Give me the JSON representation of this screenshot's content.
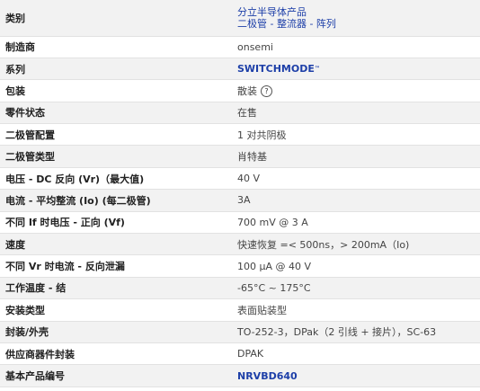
{
  "rows": [
    {
      "label": "类别",
      "links": [
        "分立半导体产品",
        "二极管 - 整流器 - 阵列"
      ]
    },
    {
      "label": "制造商",
      "value": "onsemi"
    },
    {
      "label": "系列",
      "link": "SWITCHMODE",
      "tm": "™"
    },
    {
      "label": "包装",
      "value": "散装",
      "help_icon": "question-circle-icon",
      "help_glyph": "?"
    },
    {
      "label": "零件状态",
      "value": "在售"
    },
    {
      "label": "二极管配置",
      "value": "1 对共阴极"
    },
    {
      "label": "二极管类型",
      "value": "肖特基"
    },
    {
      "label": "电压 - DC 反向 (Vr)（最大值)",
      "value": "40 V"
    },
    {
      "label": "电流 - 平均整流 (Io) (每二极管)",
      "value": "3A"
    },
    {
      "label": "不同 If 时电压 - 正向 (Vf)",
      "value": "700 mV @ 3 A"
    },
    {
      "label": "速度",
      "value": "快速恢复 =< 500ns，> 200mA（Io)"
    },
    {
      "label": "不同 Vr 时电流 - 反向泄漏",
      "value": "100 µA @ 40 V"
    },
    {
      "label": "工作温度 - 结",
      "value": "-65°C ~ 175°C"
    },
    {
      "label": "安装类型",
      "value": "表面贴装型"
    },
    {
      "label": "封装/外壳",
      "value": "TO-252-3，DPak（2 引线 + 接片），SC-63"
    },
    {
      "label": "供应商器件封装",
      "value": "DPAK"
    },
    {
      "label": "基本产品编号",
      "link": "NRVBD640"
    }
  ],
  "colors": {
    "link": "#1d3fa8",
    "row_alt": "#f2f2f2",
    "border": "#e2e2e2"
  }
}
